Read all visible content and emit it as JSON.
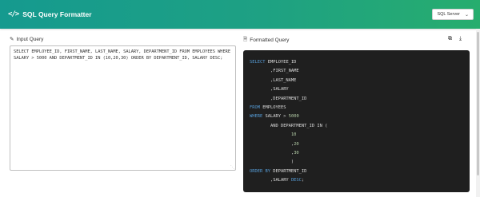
{
  "header": {
    "icon": "code-brackets-icon",
    "icon_glyph": "</>",
    "title": "SQL Query Formatter",
    "dialect_value": "SQL Server",
    "brand_color": "#1ea183"
  },
  "input_panel": {
    "label": "Input Query",
    "icon": "pencil-icon",
    "query": "SELECT EMPLOYEE_ID, FIRST_NAME, LAST_NAME, SALARY, DEPARTMENT_ID FROM EMPLOYEES WHERE SALARY > 5000 AND DEPARTMENT_ID IN (10,20,30) ORDER BY DEPARTMENT_ID, SALARY DESC;"
  },
  "output_panel": {
    "label": "Formatted Query",
    "icon": "file-icon",
    "copy_icon": "copy-icon",
    "download_icon": "download-icon",
    "background": "#1f1f1f",
    "keyword_color": "#569cd6",
    "number_color": "#b5cea8",
    "lines": [
      [
        {
          "t": "SELECT",
          "c": "kw"
        },
        {
          "t": " EMPLOYEE_ID",
          "c": ""
        }
      ],
      [
        {
          "t": "        ,FIRST_NAME",
          "c": ""
        }
      ],
      [
        {
          "t": "        ,LAST_NAME",
          "c": ""
        }
      ],
      [
        {
          "t": "        ,SALARY",
          "c": ""
        }
      ],
      [
        {
          "t": "        ,DEPARTMENT_ID",
          "c": ""
        }
      ],
      [
        {
          "t": "FROM",
          "c": "kw"
        },
        {
          "t": " EMPLOYEES",
          "c": ""
        }
      ],
      [
        {
          "t": "WHERE",
          "c": "kw"
        },
        {
          "t": " SALARY > ",
          "c": ""
        },
        {
          "t": "5000",
          "c": "num"
        }
      ],
      [
        {
          "t": "        AND DEPARTMENT_ID IN (",
          "c": ""
        }
      ],
      [
        {
          "t": "                ",
          "c": ""
        },
        {
          "t": "10",
          "c": "num"
        }
      ],
      [
        {
          "t": "                ,",
          "c": ""
        },
        {
          "t": "20",
          "c": "num"
        }
      ],
      [
        {
          "t": "                ,",
          "c": ""
        },
        {
          "t": "30",
          "c": "num"
        }
      ],
      [
        {
          "t": "                )",
          "c": ""
        }
      ],
      [
        {
          "t": "ORDER BY",
          "c": "kw"
        },
        {
          "t": " DEPARTMENT_ID",
          "c": ""
        }
      ],
      [
        {
          "t": "        ,SALARY ",
          "c": ""
        },
        {
          "t": "DESC",
          "c": "kw"
        },
        {
          "t": ";",
          "c": ""
        }
      ]
    ]
  }
}
